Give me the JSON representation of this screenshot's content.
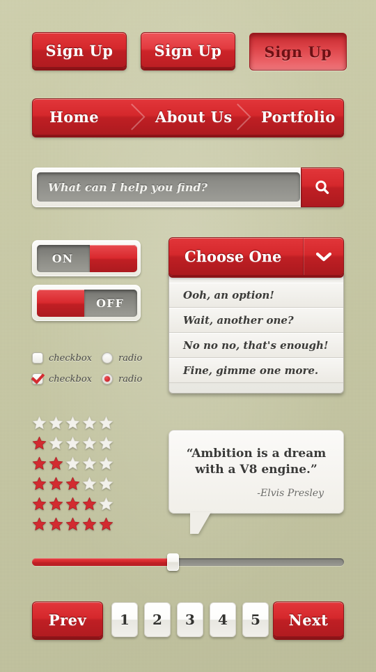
{
  "theme": {
    "background": "#c9caa8",
    "accent_red": "#d5282c",
    "accent_red_dark": "#ab191e",
    "accent_red_light": "#ef5459",
    "neutral_gray": "#8c8c86",
    "panel_white": "#f7f6f3",
    "text_dark": "#3a3a38"
  },
  "signup_buttons": [
    {
      "label": "Sign Up",
      "state": "normal"
    },
    {
      "label": "Sign Up",
      "state": "hover"
    },
    {
      "label": "Sign Up",
      "state": "pressed"
    }
  ],
  "nav": {
    "items": [
      {
        "label": "Home"
      },
      {
        "label": "About Us"
      },
      {
        "label": "Portfolio"
      }
    ]
  },
  "search": {
    "placeholder": "What can I help you find?",
    "value": "",
    "button_icon": "search-icon"
  },
  "toggles": [
    {
      "label": "ON",
      "state": "on"
    },
    {
      "label": "OFF",
      "state": "off"
    }
  ],
  "dropdown": {
    "selected_label": "Choose One",
    "arrow_icon": "chevron-down-icon",
    "options": [
      {
        "label": "Ooh, an option!"
      },
      {
        "label": "Wait, another one?"
      },
      {
        "label": "No no no, that's enough!"
      },
      {
        "label": "Fine, gimme one more."
      }
    ]
  },
  "choices": {
    "row_a": {
      "checkbox": {
        "label": "checkbox",
        "checked": false
      },
      "radio": {
        "label": "radio",
        "selected": false
      }
    },
    "row_b": {
      "checkbox": {
        "label": "checkbox",
        "checked": true
      },
      "radio": {
        "label": "radio",
        "selected": true
      }
    }
  },
  "stars": {
    "max": 5,
    "rows": [
      0,
      1,
      2,
      3,
      4,
      5
    ]
  },
  "quote": {
    "text": "“Ambition is a dream with a V8 engine.”",
    "author": "-Elvis Presley"
  },
  "slider": {
    "value_percent": 45,
    "min": 0,
    "max": 100
  },
  "pagination": {
    "prev_label": "Prev",
    "next_label": "Next",
    "pages": [
      "1",
      "2",
      "3",
      "4",
      "5"
    ]
  }
}
